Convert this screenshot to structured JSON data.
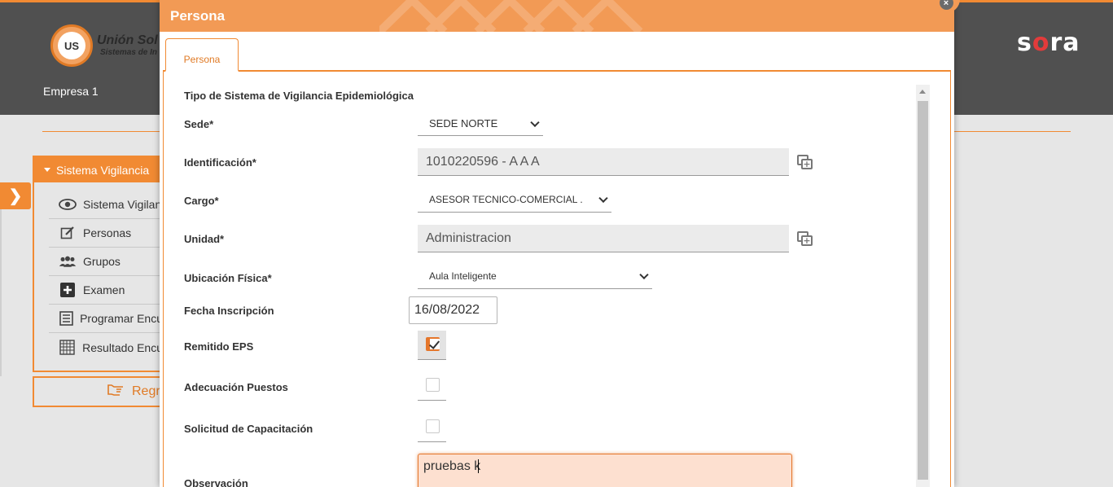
{
  "app": {
    "company_name": "Unión Sol",
    "company_tagline": "Sistemas de In",
    "logo_text": "US",
    "empresa": "Empresa 1",
    "brand": {
      "s": "s",
      "o": "o",
      "ra": "ra"
    }
  },
  "sidebar": {
    "title": "Sistema Vigilancia",
    "items": [
      {
        "label": "Sistema Vigilan",
        "icon": "eye-icon"
      },
      {
        "label": "Personas",
        "icon": "edit-icon"
      },
      {
        "label": "Grupos",
        "icon": "users-icon"
      },
      {
        "label": "Examen",
        "icon": "plus-square-icon"
      },
      {
        "label": "Programar Encu",
        "icon": "list-icon"
      },
      {
        "label": "Resultado Encu",
        "icon": "grid-icon"
      }
    ],
    "back_label": "Regre"
  },
  "modal": {
    "title": "Persona",
    "close_glyph": "×",
    "tab": "Persona",
    "section_title": "Tipo de Sistema de Vigilancia Epidemiológica",
    "fields": {
      "sede": {
        "label": "Sede*",
        "value": "SEDE NORTE"
      },
      "identificacion": {
        "label": "Identificación*",
        "value": "1010220596 - A A A"
      },
      "cargo": {
        "label": "Cargo*",
        "value": "ASESOR TECNICO-COMERCIAL ."
      },
      "unidad": {
        "label": "Unidad*",
        "value": "Administracion"
      },
      "ubicacion": {
        "label": "Ubicación Física*",
        "value": "Aula Inteligente"
      },
      "fecha": {
        "label": "Fecha Inscripción",
        "value": "16/08/2022"
      },
      "remitido": {
        "label": "Remitido EPS",
        "checked": true
      },
      "adecuacion": {
        "label": "Adecuación Puestos",
        "checked": false
      },
      "capacitacion": {
        "label": "Solicitud de Capacitación",
        "checked": false
      },
      "observacion": {
        "label": "Observación",
        "value": "pruebas k"
      }
    }
  },
  "colors": {
    "accent": "#f18a33",
    "header_bg": "#505050",
    "modal_header": "#f29a55",
    "textarea_bg": "#fde0d0"
  }
}
